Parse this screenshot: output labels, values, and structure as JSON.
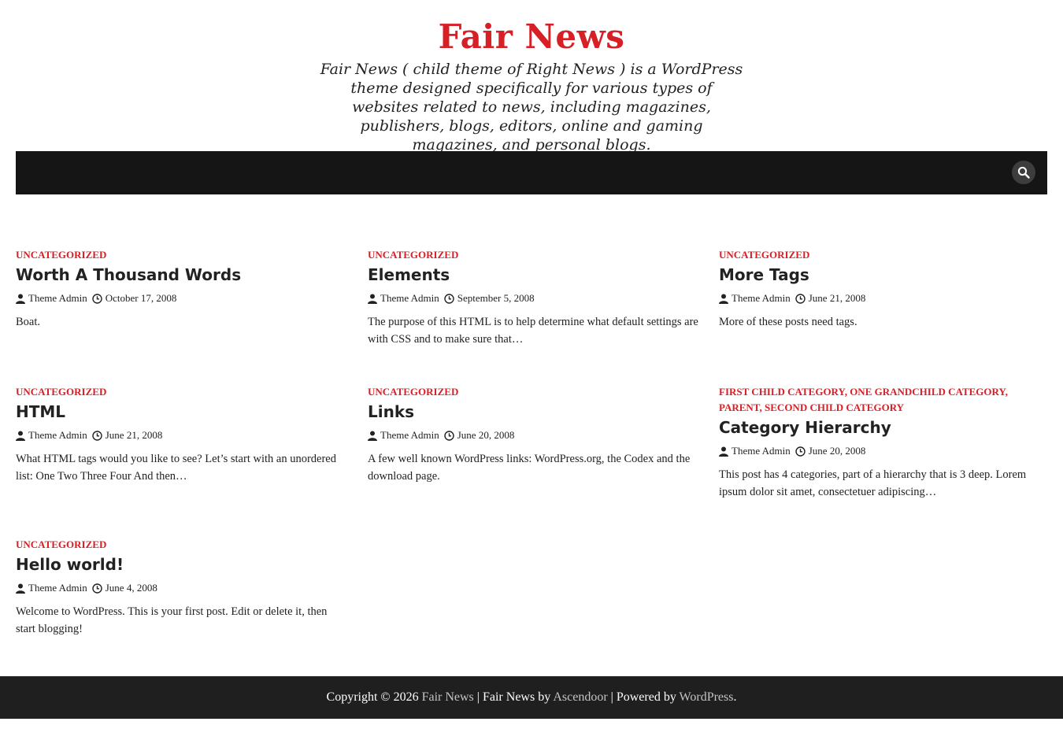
{
  "site": {
    "title": "Fair News",
    "description": "Fair News ( child theme of Right News ) is a WordPress theme designed specifically for various types of websites related to news, including magazines, publishers, blogs, editors, online and gaming magazines, and personal blogs."
  },
  "colors": {
    "accent": "#d71f26",
    "nav_bg": "#151515",
    "footer_bg": "#1f1f1f"
  },
  "nav": {
    "search_icon": "search-icon"
  },
  "posts": [
    {
      "cats": [
        "UNCATEGORIZED"
      ],
      "title": "Worth A Thousand Words",
      "author": "Theme Admin",
      "date": "October 17, 2008",
      "excerpt": "Boat."
    },
    {
      "cats": [
        "UNCATEGORIZED"
      ],
      "title": "Elements",
      "author": "Theme Admin",
      "date": "September 5, 2008",
      "excerpt": "The purpose of this HTML is to help determine what default settings are with CSS and to make sure that…"
    },
    {
      "cats": [
        "UNCATEGORIZED"
      ],
      "title": "More Tags",
      "author": "Theme Admin",
      "date": "June 21, 2008",
      "excerpt": "More of these posts need tags."
    },
    {
      "cats": [
        "UNCATEGORIZED"
      ],
      "title": "HTML",
      "author": "Theme Admin",
      "date": "June 21, 2008",
      "excerpt": "What HTML tags would you like to see? Let’s start with an unordered list: One Two Three Four And then…"
    },
    {
      "cats": [
        "UNCATEGORIZED"
      ],
      "title": "Links",
      "author": "Theme Admin",
      "date": "June 20, 2008",
      "excerpt": "A few well known WordPress links: WordPress.org, the Codex and the download page."
    },
    {
      "cats": [
        "FIRST CHILD CATEGORY",
        "ONE GRANDCHILD CATEGORY",
        "PARENT",
        "SECOND CHILD CATEGORY"
      ],
      "title": "Category Hierarchy",
      "author": "Theme Admin",
      "date": "June 20, 2008",
      "excerpt": "This post has 4 categories, part of a hierarchy that is 3 deep. Lorem ipsum dolor sit amet, consectetuer adipiscing…"
    },
    {
      "cats": [
        "UNCATEGORIZED"
      ],
      "title": "Hello world!",
      "author": "Theme Admin",
      "date": "June 4, 2008",
      "excerpt": "Welcome to WordPress. This is your first post. Edit or delete it, then start blogging!"
    }
  ],
  "footer": {
    "copyright": "Copyright © 2026",
    "site_link": "Fair News",
    "sep1": "|",
    "theme_text": "Fair News by",
    "author_link": "Ascendoor",
    "sep2": "|",
    "powered_text": "Powered by",
    "wp_link": "WordPress",
    "end": "."
  }
}
